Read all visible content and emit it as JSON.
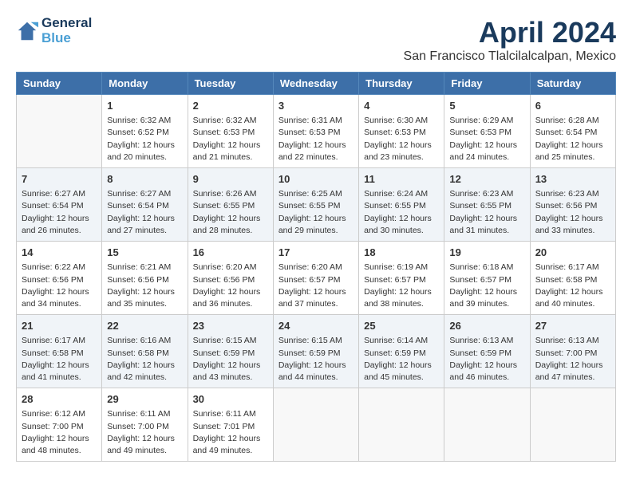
{
  "header": {
    "logo_line1": "General",
    "logo_line2": "Blue",
    "month": "April 2024",
    "location": "San Francisco Tlalcilalcalpan, Mexico"
  },
  "weekdays": [
    "Sunday",
    "Monday",
    "Tuesday",
    "Wednesday",
    "Thursday",
    "Friday",
    "Saturday"
  ],
  "weeks": [
    [
      {
        "day": "",
        "sunrise": "",
        "sunset": "",
        "daylight": ""
      },
      {
        "day": "1",
        "sunrise": "Sunrise: 6:32 AM",
        "sunset": "Sunset: 6:52 PM",
        "daylight": "Daylight: 12 hours and 20 minutes."
      },
      {
        "day": "2",
        "sunrise": "Sunrise: 6:32 AM",
        "sunset": "Sunset: 6:53 PM",
        "daylight": "Daylight: 12 hours and 21 minutes."
      },
      {
        "day": "3",
        "sunrise": "Sunrise: 6:31 AM",
        "sunset": "Sunset: 6:53 PM",
        "daylight": "Daylight: 12 hours and 22 minutes."
      },
      {
        "day": "4",
        "sunrise": "Sunrise: 6:30 AM",
        "sunset": "Sunset: 6:53 PM",
        "daylight": "Daylight: 12 hours and 23 minutes."
      },
      {
        "day": "5",
        "sunrise": "Sunrise: 6:29 AM",
        "sunset": "Sunset: 6:53 PM",
        "daylight": "Daylight: 12 hours and 24 minutes."
      },
      {
        "day": "6",
        "sunrise": "Sunrise: 6:28 AM",
        "sunset": "Sunset: 6:54 PM",
        "daylight": "Daylight: 12 hours and 25 minutes."
      }
    ],
    [
      {
        "day": "7",
        "sunrise": "Sunrise: 6:27 AM",
        "sunset": "Sunset: 6:54 PM",
        "daylight": "Daylight: 12 hours and 26 minutes."
      },
      {
        "day": "8",
        "sunrise": "Sunrise: 6:27 AM",
        "sunset": "Sunset: 6:54 PM",
        "daylight": "Daylight: 12 hours and 27 minutes."
      },
      {
        "day": "9",
        "sunrise": "Sunrise: 6:26 AM",
        "sunset": "Sunset: 6:55 PM",
        "daylight": "Daylight: 12 hours and 28 minutes."
      },
      {
        "day": "10",
        "sunrise": "Sunrise: 6:25 AM",
        "sunset": "Sunset: 6:55 PM",
        "daylight": "Daylight: 12 hours and 29 minutes."
      },
      {
        "day": "11",
        "sunrise": "Sunrise: 6:24 AM",
        "sunset": "Sunset: 6:55 PM",
        "daylight": "Daylight: 12 hours and 30 minutes."
      },
      {
        "day": "12",
        "sunrise": "Sunrise: 6:23 AM",
        "sunset": "Sunset: 6:55 PM",
        "daylight": "Daylight: 12 hours and 31 minutes."
      },
      {
        "day": "13",
        "sunrise": "Sunrise: 6:23 AM",
        "sunset": "Sunset: 6:56 PM",
        "daylight": "Daylight: 12 hours and 33 minutes."
      }
    ],
    [
      {
        "day": "14",
        "sunrise": "Sunrise: 6:22 AM",
        "sunset": "Sunset: 6:56 PM",
        "daylight": "Daylight: 12 hours and 34 minutes."
      },
      {
        "day": "15",
        "sunrise": "Sunrise: 6:21 AM",
        "sunset": "Sunset: 6:56 PM",
        "daylight": "Daylight: 12 hours and 35 minutes."
      },
      {
        "day": "16",
        "sunrise": "Sunrise: 6:20 AM",
        "sunset": "Sunset: 6:56 PM",
        "daylight": "Daylight: 12 hours and 36 minutes."
      },
      {
        "day": "17",
        "sunrise": "Sunrise: 6:20 AM",
        "sunset": "Sunset: 6:57 PM",
        "daylight": "Daylight: 12 hours and 37 minutes."
      },
      {
        "day": "18",
        "sunrise": "Sunrise: 6:19 AM",
        "sunset": "Sunset: 6:57 PM",
        "daylight": "Daylight: 12 hours and 38 minutes."
      },
      {
        "day": "19",
        "sunrise": "Sunrise: 6:18 AM",
        "sunset": "Sunset: 6:57 PM",
        "daylight": "Daylight: 12 hours and 39 minutes."
      },
      {
        "day": "20",
        "sunrise": "Sunrise: 6:17 AM",
        "sunset": "Sunset: 6:58 PM",
        "daylight": "Daylight: 12 hours and 40 minutes."
      }
    ],
    [
      {
        "day": "21",
        "sunrise": "Sunrise: 6:17 AM",
        "sunset": "Sunset: 6:58 PM",
        "daylight": "Daylight: 12 hours and 41 minutes."
      },
      {
        "day": "22",
        "sunrise": "Sunrise: 6:16 AM",
        "sunset": "Sunset: 6:58 PM",
        "daylight": "Daylight: 12 hours and 42 minutes."
      },
      {
        "day": "23",
        "sunrise": "Sunrise: 6:15 AM",
        "sunset": "Sunset: 6:59 PM",
        "daylight": "Daylight: 12 hours and 43 minutes."
      },
      {
        "day": "24",
        "sunrise": "Sunrise: 6:15 AM",
        "sunset": "Sunset: 6:59 PM",
        "daylight": "Daylight: 12 hours and 44 minutes."
      },
      {
        "day": "25",
        "sunrise": "Sunrise: 6:14 AM",
        "sunset": "Sunset: 6:59 PM",
        "daylight": "Daylight: 12 hours and 45 minutes."
      },
      {
        "day": "26",
        "sunrise": "Sunrise: 6:13 AM",
        "sunset": "Sunset: 6:59 PM",
        "daylight": "Daylight: 12 hours and 46 minutes."
      },
      {
        "day": "27",
        "sunrise": "Sunrise: 6:13 AM",
        "sunset": "Sunset: 7:00 PM",
        "daylight": "Daylight: 12 hours and 47 minutes."
      }
    ],
    [
      {
        "day": "28",
        "sunrise": "Sunrise: 6:12 AM",
        "sunset": "Sunset: 7:00 PM",
        "daylight": "Daylight: 12 hours and 48 minutes."
      },
      {
        "day": "29",
        "sunrise": "Sunrise: 6:11 AM",
        "sunset": "Sunset: 7:00 PM",
        "daylight": "Daylight: 12 hours and 49 minutes."
      },
      {
        "day": "30",
        "sunrise": "Sunrise: 6:11 AM",
        "sunset": "Sunset: 7:01 PM",
        "daylight": "Daylight: 12 hours and 49 minutes."
      },
      {
        "day": "",
        "sunrise": "",
        "sunset": "",
        "daylight": ""
      },
      {
        "day": "",
        "sunrise": "",
        "sunset": "",
        "daylight": ""
      },
      {
        "day": "",
        "sunrise": "",
        "sunset": "",
        "daylight": ""
      },
      {
        "day": "",
        "sunrise": "",
        "sunset": "",
        "daylight": ""
      }
    ]
  ]
}
